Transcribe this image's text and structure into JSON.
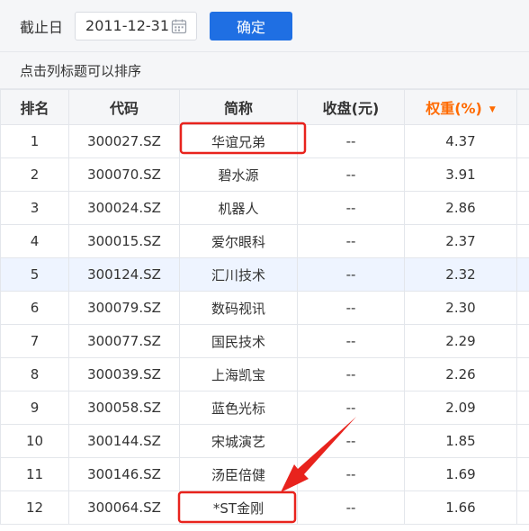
{
  "filter": {
    "date_label": "截止日",
    "date_value": "2011-12-31",
    "confirm_label": "确定"
  },
  "hint": "点击列标题可以排序",
  "columns": [
    "排名",
    "代码",
    "简称",
    "收盘(元)",
    "权重(%)"
  ],
  "sort": {
    "column": "权重(%)",
    "direction": "desc",
    "indicator_color": "#ff6a00"
  },
  "rows": [
    {
      "rank": "1",
      "code": "300027.SZ",
      "name": "华谊兄弟",
      "close": "--",
      "weight": "4.37"
    },
    {
      "rank": "2",
      "code": "300070.SZ",
      "name": "碧水源",
      "close": "--",
      "weight": "3.91"
    },
    {
      "rank": "3",
      "code": "300024.SZ",
      "name": "机器人",
      "close": "--",
      "weight": "2.86"
    },
    {
      "rank": "4",
      "code": "300015.SZ",
      "name": "爱尔眼科",
      "close": "--",
      "weight": "2.37"
    },
    {
      "rank": "5",
      "code": "300124.SZ",
      "name": "汇川技术",
      "close": "--",
      "weight": "2.32"
    },
    {
      "rank": "6",
      "code": "300079.SZ",
      "name": "数码视讯",
      "close": "--",
      "weight": "2.30"
    },
    {
      "rank": "7",
      "code": "300077.SZ",
      "name": "国民技术",
      "close": "--",
      "weight": "2.29"
    },
    {
      "rank": "8",
      "code": "300039.SZ",
      "name": "上海凯宝",
      "close": "--",
      "weight": "2.26"
    },
    {
      "rank": "9",
      "code": "300058.SZ",
      "name": "蓝色光标",
      "close": "--",
      "weight": "2.09"
    },
    {
      "rank": "10",
      "code": "300144.SZ",
      "name": "宋城演艺",
      "close": "--",
      "weight": "1.85"
    },
    {
      "rank": "11",
      "code": "300146.SZ",
      "name": "汤臣倍健",
      "close": "--",
      "weight": "1.69"
    },
    {
      "rank": "12",
      "code": "300064.SZ",
      "name": "*ST金刚",
      "close": "--",
      "weight": "1.66"
    }
  ],
  "highlighted_row_rank": "5",
  "colors": {
    "accent_button": "#1f6fe3",
    "annotation_red": "#e8231d",
    "row_highlight": "#eef4ff"
  },
  "annotations": {
    "boxed_names": [
      "华谊兄弟",
      "*ST金刚"
    ],
    "arrow_target": "*ST金刚"
  }
}
